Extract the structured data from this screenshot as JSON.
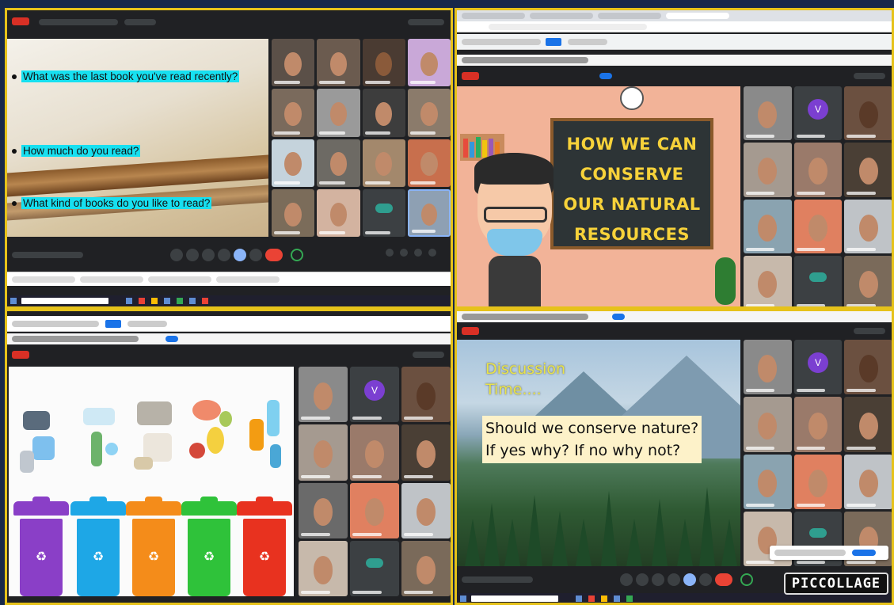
{
  "panels": [
    {
      "id": "reading-discussion",
      "slide": {
        "questions": [
          "What was the last book you've read recently?",
          "How much do you read?",
          "What kind of books do you like to read?"
        ]
      }
    },
    {
      "id": "conserve-resources",
      "slide": {
        "chalkboard_lines": [
          "HOW WE CAN",
          "CONSERVE",
          "OUR NATURAL",
          "RESOURCES"
        ]
      },
      "participants": {
        "avatar_letter": "V"
      }
    },
    {
      "id": "recycling-bins",
      "slide": {
        "bin_colors": [
          "#8a3fc7",
          "#1ea7e6",
          "#f48c1a",
          "#2fc23a",
          "#e8321f"
        ]
      },
      "participants": {
        "avatar_letter": "V"
      }
    },
    {
      "id": "nature-discussion",
      "slide": {
        "title": "Discussion Time....",
        "questions": [
          "Should we conserve nature?",
          "If yes why? If no why not?"
        ]
      },
      "participants": {
        "avatar_letter": "V"
      },
      "watermark": "PICCOLLAGE"
    }
  ],
  "colors": {
    "frame": "#e6c21a",
    "meet_bg": "#202124",
    "end_call": "#ea4335",
    "highlight": "#17e0f0",
    "chalk_text": "#f7d23a"
  }
}
